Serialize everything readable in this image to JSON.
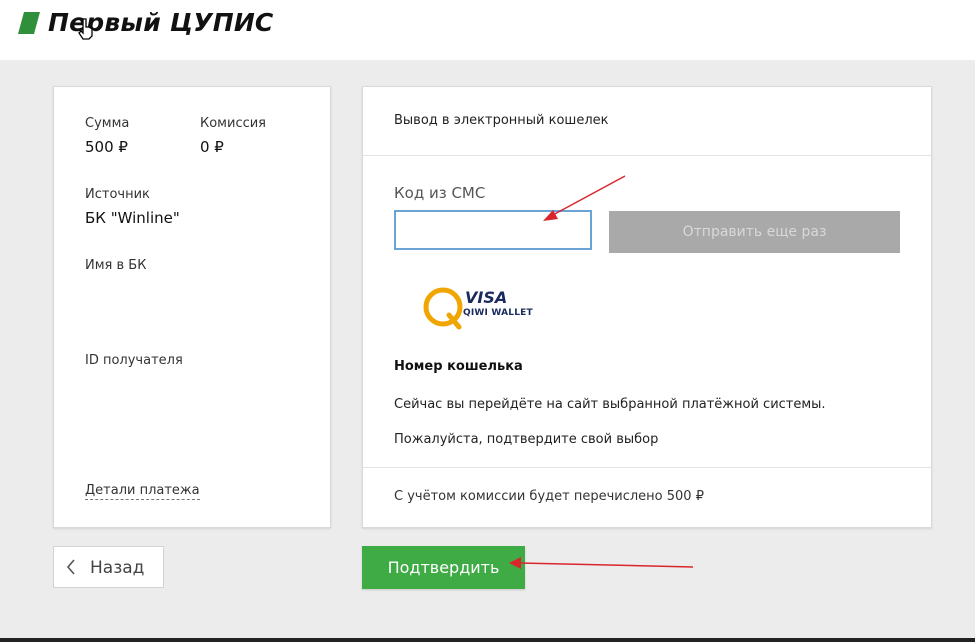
{
  "header": {
    "logo_text": "Первый ЦУПИС",
    "brand_color": "#2f8f3a",
    "logo_icon": "green-parallelogram-icon",
    "cursor_icon": "hand-pointer-icon"
  },
  "summary": {
    "amount_label": "Сумма",
    "amount_value": "500 ₽",
    "commission_label": "Комиссия",
    "commission_value": "0 ₽",
    "source_label": "Источник",
    "source_value": "БК \"Winline\"",
    "bk_name_label": "Имя в БК",
    "recipient_id_label": "ID получателя",
    "details_link": "Детали платежа"
  },
  "withdrawal": {
    "title": "Вывод в электронный кошелек",
    "sms_label": "Код из СМС",
    "sms_value": "",
    "resend_button": "Отправить еще раз",
    "wallet_logo": {
      "icon": "qiwi-q-icon",
      "visa_text": "VISA",
      "wallet_text": "QIWI WALLET"
    },
    "wallet_number_label": "Номер кошелька",
    "redirect_info": "Сейчас вы перейдёте на сайт выбранной платёжной системы.",
    "confirm_info": "Пожалуйста, подтвердите свой выбор",
    "footer_note": "С учётом комиссии будет перечислено 500 ₽"
  },
  "actions": {
    "back_label": "Назад",
    "back_icon": "chevron-left-icon",
    "confirm_label": "Подтвердить",
    "confirm_color": "#3eab45"
  },
  "annotations": {
    "arrow_color": "#d9262c",
    "arrow_icon": "red-arrow-icon"
  }
}
